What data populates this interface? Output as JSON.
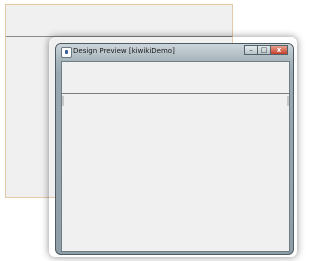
{
  "preview_window": {
    "title": "Design Preview [kiwikiDemo]",
    "buttons": {
      "minimize": "–",
      "maximize": "□",
      "close": "x"
    }
  },
  "colors": {
    "back_window_border": "#e3c9a8",
    "panel_background": "#f0f0f0",
    "close_button": "#c7402b"
  }
}
